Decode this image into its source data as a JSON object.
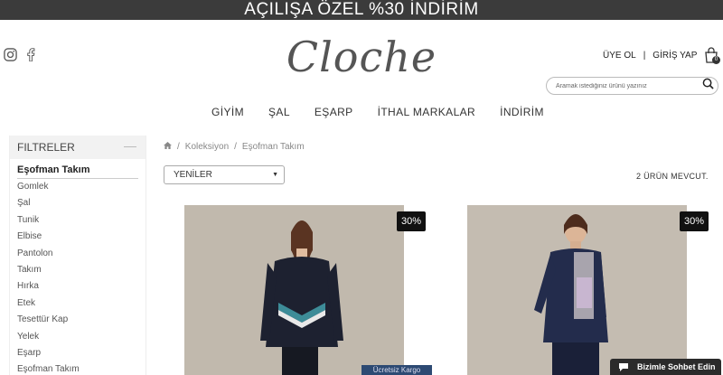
{
  "promo": {
    "text": "AÇILIŞA ÖZEL %30 İNDİRİM"
  },
  "brand": {
    "logo_text": "Cloche"
  },
  "account": {
    "signup": "ÜYE OL",
    "separator": "|",
    "login": "GİRİŞ YAP"
  },
  "cart": {
    "count": "0"
  },
  "search": {
    "placeholder": "Aramak istediğiniz ürünü yazınız"
  },
  "nav": {
    "items": [
      "GİYİM",
      "ŞAL",
      "EŞARP",
      "İTHAL MARKALAR",
      "İNDİRİM"
    ]
  },
  "filters": {
    "title": "FILTRELER",
    "active": "Eşofman Takım",
    "items": [
      "Gomlek",
      "Şal",
      "Tunik",
      "Elbise",
      "Pantolon",
      "Takım",
      "Hırka",
      "Etek",
      "Tesettür Kap",
      "Yelek",
      "Eşarp",
      "Eşofman Takım"
    ]
  },
  "breadcrumb": {
    "items": [
      "Koleksiyon",
      "Eşofman Takım"
    ],
    "separator": "/"
  },
  "sort": {
    "selected": "YENİLER"
  },
  "results": {
    "count_text": "2 ÜRÜN MEVCUT."
  },
  "products": [
    {
      "badge": "30%",
      "tag": "Ücretsiz Kargo"
    },
    {
      "badge": "30%"
    }
  ],
  "chat": {
    "label": "Bizimle Sohbet Edin"
  },
  "icons": [
    "instagram-icon",
    "facebook-icon",
    "bag-icon",
    "search-icon",
    "home-icon",
    "chevron-down-icon",
    "chat-icon"
  ]
}
